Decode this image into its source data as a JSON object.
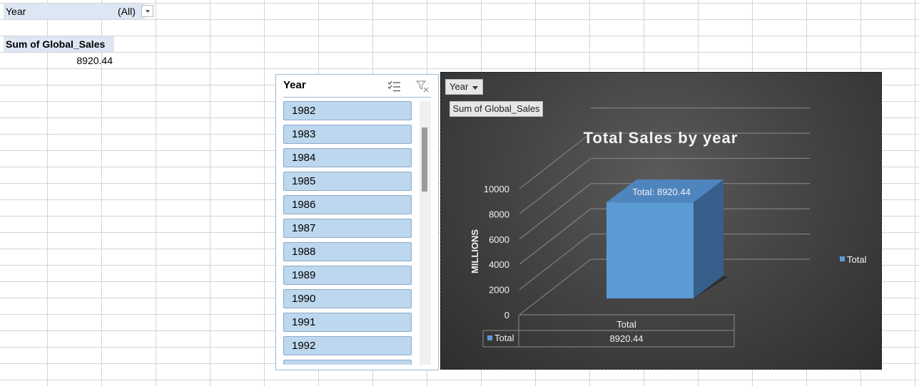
{
  "pivot": {
    "filter_label": "Year",
    "filter_value": "(All)",
    "sum_header": "Sum of Global_Sales",
    "sum_value": "8920.44"
  },
  "slicer": {
    "title": "Year",
    "items": [
      "1982",
      "1983",
      "1984",
      "1985",
      "1986",
      "1987",
      "1988",
      "1989",
      "1990",
      "1991",
      "1992"
    ]
  },
  "chart": {
    "year_button": "Year",
    "sum_button": "Sum of Global_Sales",
    "colors": {
      "bar": "#5b9bd5",
      "background": "#3f3f3f"
    }
  },
  "chart_data": {
    "type": "bar",
    "title": "Total Sales by year",
    "ylabel": "MILLIONS",
    "categories": [
      "Total"
    ],
    "series": [
      {
        "name": "Total",
        "values": [
          8920.44
        ]
      }
    ],
    "ylim": [
      0,
      10000
    ],
    "yticks": [
      "0",
      "2000",
      "4000",
      "6000",
      "8000",
      "10000"
    ],
    "data_label": "Total:  8920.44",
    "legend": "right",
    "data_table": {
      "series_label": "Total",
      "category_label": "Total",
      "value": "8920.44"
    }
  }
}
